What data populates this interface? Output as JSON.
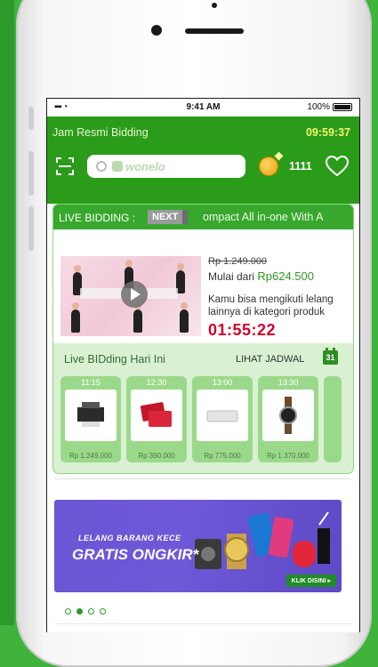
{
  "status_bar": {
    "time": "9:41 AM",
    "battery": "100%"
  },
  "header": {
    "title": "Jam Resmi Bidding",
    "timer": "09:59:37",
    "search_brand": "wonelo",
    "coin_count": "1111"
  },
  "live": {
    "label": "LIVE BIDDING :",
    "next_label": "NEXT",
    "ticker": "ompact All in-one With A",
    "old_price": "Rp 1.249.000",
    "from_label": "Mulai dari",
    "from_price": "Rp624.500",
    "description": "Kamu bisa mengikuti lelang lainnya di kategori produk",
    "countdown": "01:55:22"
  },
  "today": {
    "title": "Live BIDding Hari Ini",
    "schedule_link": "LIHAT JADWAL",
    "calendar_day": "31",
    "slots": [
      {
        "time": "11:15",
        "price": "Rp 1.249.000",
        "icon": "printer-icon"
      },
      {
        "time": "12:30",
        "price": "Rp 390.000",
        "icon": "gift-card-icon"
      },
      {
        "time": "13:00",
        "price": "Rp 775.000",
        "icon": "router-icon"
      },
      {
        "time": "13:30",
        "price": "Rp 1.370.000",
        "icon": "watch-icon"
      }
    ]
  },
  "promo": {
    "line1": "LELANG BARANG KECE",
    "line2": "GRATIS ONGKIR*",
    "cta": "KLIK DISINI ▸"
  },
  "colors": {
    "primary": "#2b9c1a",
    "accent_timer": "#f2f86a",
    "countdown": "#d0022a",
    "promo_bg": "#6a55d3"
  }
}
